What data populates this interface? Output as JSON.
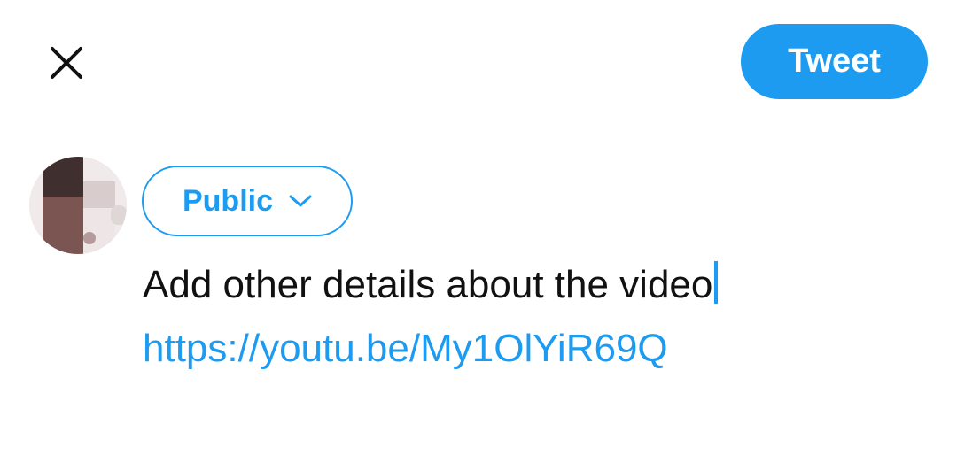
{
  "header": {
    "close_icon": "close-icon",
    "tweet_label": "Tweet"
  },
  "composer": {
    "avatar_icon": "avatar",
    "audience": {
      "label": "Public",
      "icon": "chevron-down-icon"
    },
    "text": "Add other details about the video",
    "link": "https://youtu.be/My1OlYiR69Q"
  },
  "colors": {
    "accent": "#1d9bf0",
    "text": "#111111",
    "background": "#ffffff"
  }
}
